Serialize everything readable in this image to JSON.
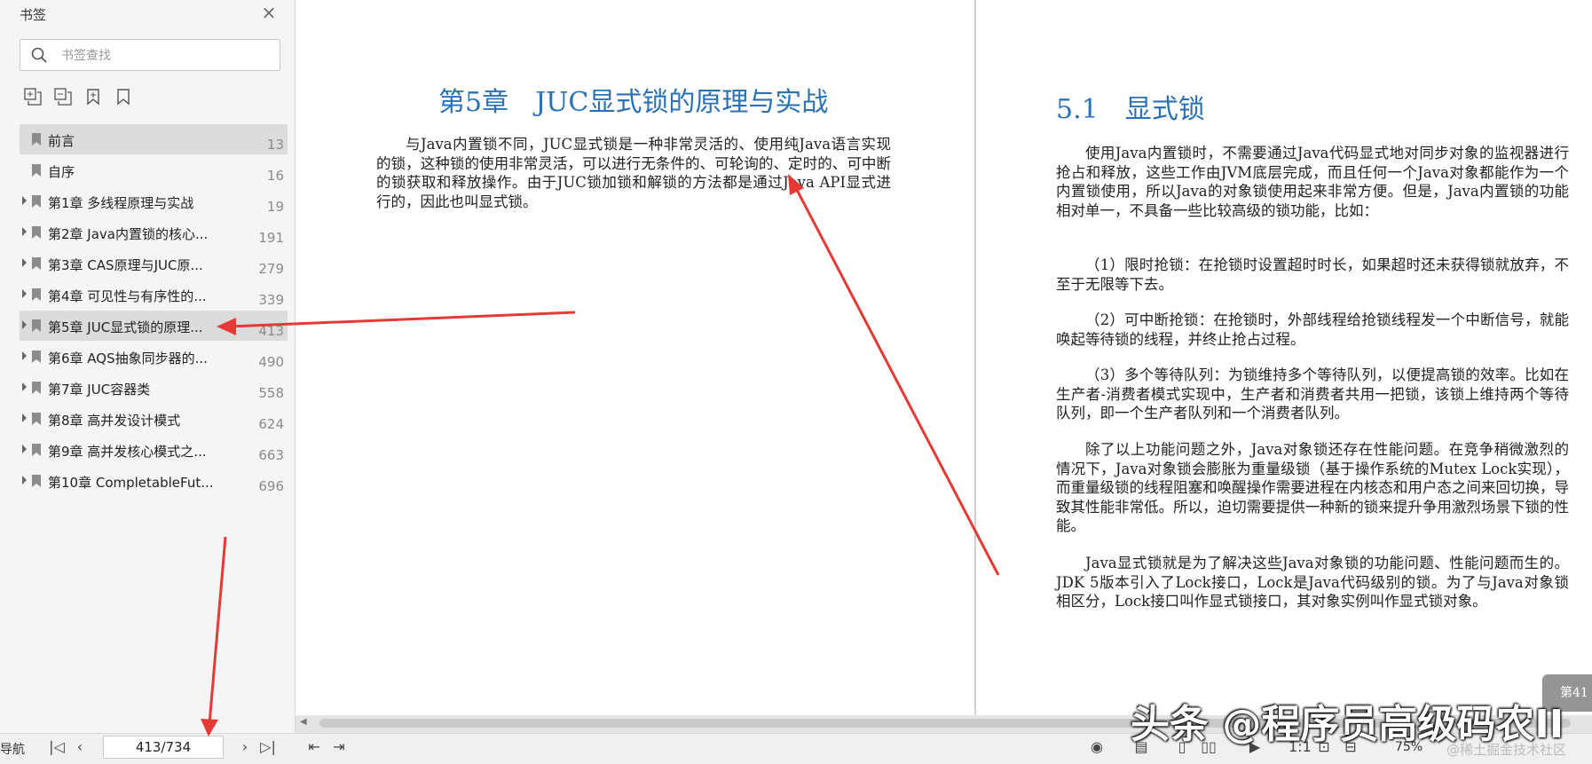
{
  "sidebar": {
    "title": "书签",
    "close_icon": "close-icon",
    "search": {
      "placeholder": "书签查找",
      "value": ""
    },
    "toolbar_icons": [
      "expand-all-icon",
      "collapse-all-icon",
      "add-bookmark-icon",
      "bookmark-icon"
    ],
    "items": [
      {
        "label": "前言",
        "page": "13",
        "expandable": false
      },
      {
        "label": "自序",
        "page": "16",
        "expandable": false
      },
      {
        "label": "第1章 多线程原理与实战",
        "page": "19",
        "expandable": true
      },
      {
        "label": "第2章 Java内置锁的核心...",
        "page": "191",
        "expandable": true
      },
      {
        "label": "第3章 CAS原理与JUC原...",
        "page": "279",
        "expandable": true
      },
      {
        "label": "第4章 可见性与有序性的...",
        "page": "339",
        "expandable": true
      },
      {
        "label": "第5章 JUC显式锁的原理...",
        "page": "413",
        "expandable": true,
        "selected": true
      },
      {
        "label": "第6章 AQS抽象同步器的...",
        "page": "490",
        "expandable": true
      },
      {
        "label": "第7章 JUC容器类",
        "page": "558",
        "expandable": true
      },
      {
        "label": "第8章 高并发设计模式",
        "page": "624",
        "expandable": true
      },
      {
        "label": "第9章 高并发核心模式之...",
        "page": "663",
        "expandable": true
      },
      {
        "label": "第10章 CompletableFut...",
        "page": "696",
        "expandable": true
      }
    ]
  },
  "document": {
    "left_page": {
      "chapter_title": "第5章　JUC显式锁的原理与实战",
      "paragraph": "与Java内置锁不同，JUC显式锁是一种非常灵活的、使用纯Java语言实现的锁，这种锁的使用非常灵活，可以进行无条件的、可轮询的、定时的、可中断的锁获取和释放操作。由于JUC锁加锁和解锁的方法都是通过Java API显式进行的，因此也叫显式锁。"
    },
    "right_page": {
      "section_title": "5.1　显式锁",
      "paragraphs": [
        "使用Java内置锁时，不需要通过Java代码显式地对同步对象的监视器进行抢占和释放，这些工作由JVM底层完成，而且任何一个Java对象都能作为一个内置锁使用，所以Java的对象锁使用起来非常方便。但是，Java内置锁的功能相对单一，不具备一些比较高级的锁功能，比如：",
        "（1）限时抢锁：在抢锁时设置超时时长，如果超时还未获得锁就放弃，不至于无限等下去。",
        "（2）可中断抢锁：在抢锁时，外部线程给抢锁线程发一个中断信号，就能唤起等待锁的线程，并终止抢占过程。",
        "（3）多个等待队列：为锁维持多个等待队列，以便提高锁的效率。比如在生产者-消费者模式实现中，生产者和消费者共用一把锁，该锁上维持两个等待队列，即一个生产者队列和一个消费者队列。",
        "除了以上功能问题之外，Java对象锁还存在性能问题。在竞争稍微激烈的情况下，Java对象锁会膨胀为重量级锁（基于操作系统的Mutex Lock实现），而重量级锁的线程阻塞和唤醒操作需要进程在内核态和用户态之间来回切换，导致其性能非常低。所以，迫切需要提供一种新的锁来提升争用激烈场景下锁的性能。",
        "Java显式锁就是为了解决这些Java对象锁的功能问题、性能问题而生的。JDK 5版本引入了Lock接口，Lock是Java代码级别的锁。为了与Java对象锁相区分，Lock接口叫作显式锁接口，其对象实例叫作显式锁对象。"
      ],
      "page_badge": "第41"
    }
  },
  "statusbar": {
    "nav_label": "导航",
    "page_value": "413/734",
    "zoom": "75%"
  },
  "watermark": {
    "main": "头条 @程序员高级码农II",
    "sub": "@稀土掘金技术社区"
  },
  "colors": {
    "heading": "#2a72b5",
    "arrow": "#e53935"
  }
}
